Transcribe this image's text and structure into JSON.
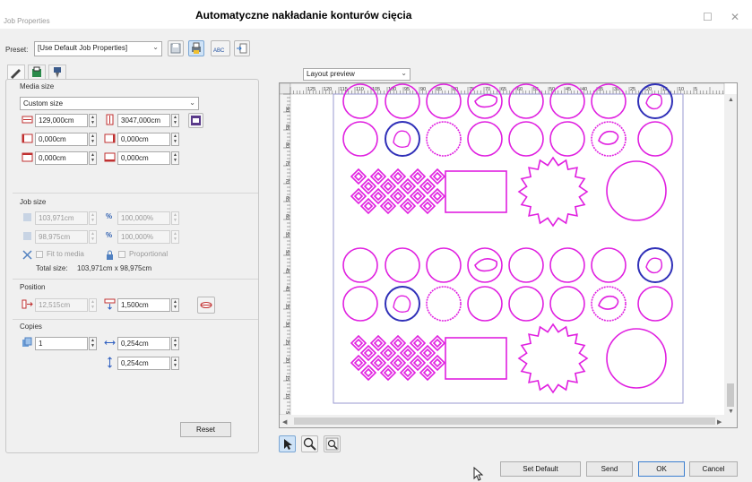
{
  "window": {
    "title": "Job Properties",
    "caption": "Automatyczne nakładanie konturów cięcia"
  },
  "preset": {
    "label": "Preset:",
    "value": "[Use Default Job Properties]"
  },
  "media": {
    "heading": "Media size",
    "size_option": "Custom size",
    "width": "129,000cm",
    "height": "3047,000cm",
    "margin_left": "0,000cm",
    "margin_right": "0,000cm",
    "margin_top": "0,000cm",
    "margin_bottom": "0,000cm"
  },
  "job": {
    "heading": "Job size",
    "width": "103,971cm",
    "width_pct": "100,000%",
    "height": "98,975cm",
    "height_pct": "100,000%",
    "fit_label": "Fit to media",
    "prop_label": "Proportional",
    "total_label": "Total size:",
    "total_value": "103,971cm x 98,975cm"
  },
  "position": {
    "heading": "Position",
    "x": "12,515cm",
    "y": "1,500cm"
  },
  "copies": {
    "heading": "Copies",
    "count": "1",
    "h_gap": "0,254cm",
    "v_gap": "0,254cm"
  },
  "buttons": {
    "reset": "Reset",
    "set_default": "Set Default",
    "send": "Send",
    "ok": "OK",
    "cancel": "Cancel"
  },
  "preview": {
    "mode": "Layout preview",
    "ruler_ticks": [
      "125",
      "120",
      "115",
      "110",
      "105",
      "100",
      "95",
      "90",
      "85",
      "80",
      "75",
      "70",
      "65",
      "60",
      "55",
      "50",
      "45",
      "40",
      "35",
      "30",
      "25",
      "20",
      "15",
      "10",
      "5"
    ],
    "vruler_ticks": [
      "90",
      "85",
      "80",
      "75",
      "70",
      "65",
      "60",
      "55",
      "50",
      "45",
      "40",
      "35",
      "30",
      "25",
      "20",
      "15",
      "10",
      "5"
    ]
  },
  "colors": {
    "contour": "#e020e0",
    "selected": "#3030b8",
    "accent": "#3c7fd0"
  },
  "icons": [
    "close-icon",
    "maximize-icon",
    "save-icon",
    "print-icon",
    "abc-icon",
    "export-icon",
    "pointer-icon",
    "zoom-in-icon",
    "zoom-fit-icon"
  ]
}
